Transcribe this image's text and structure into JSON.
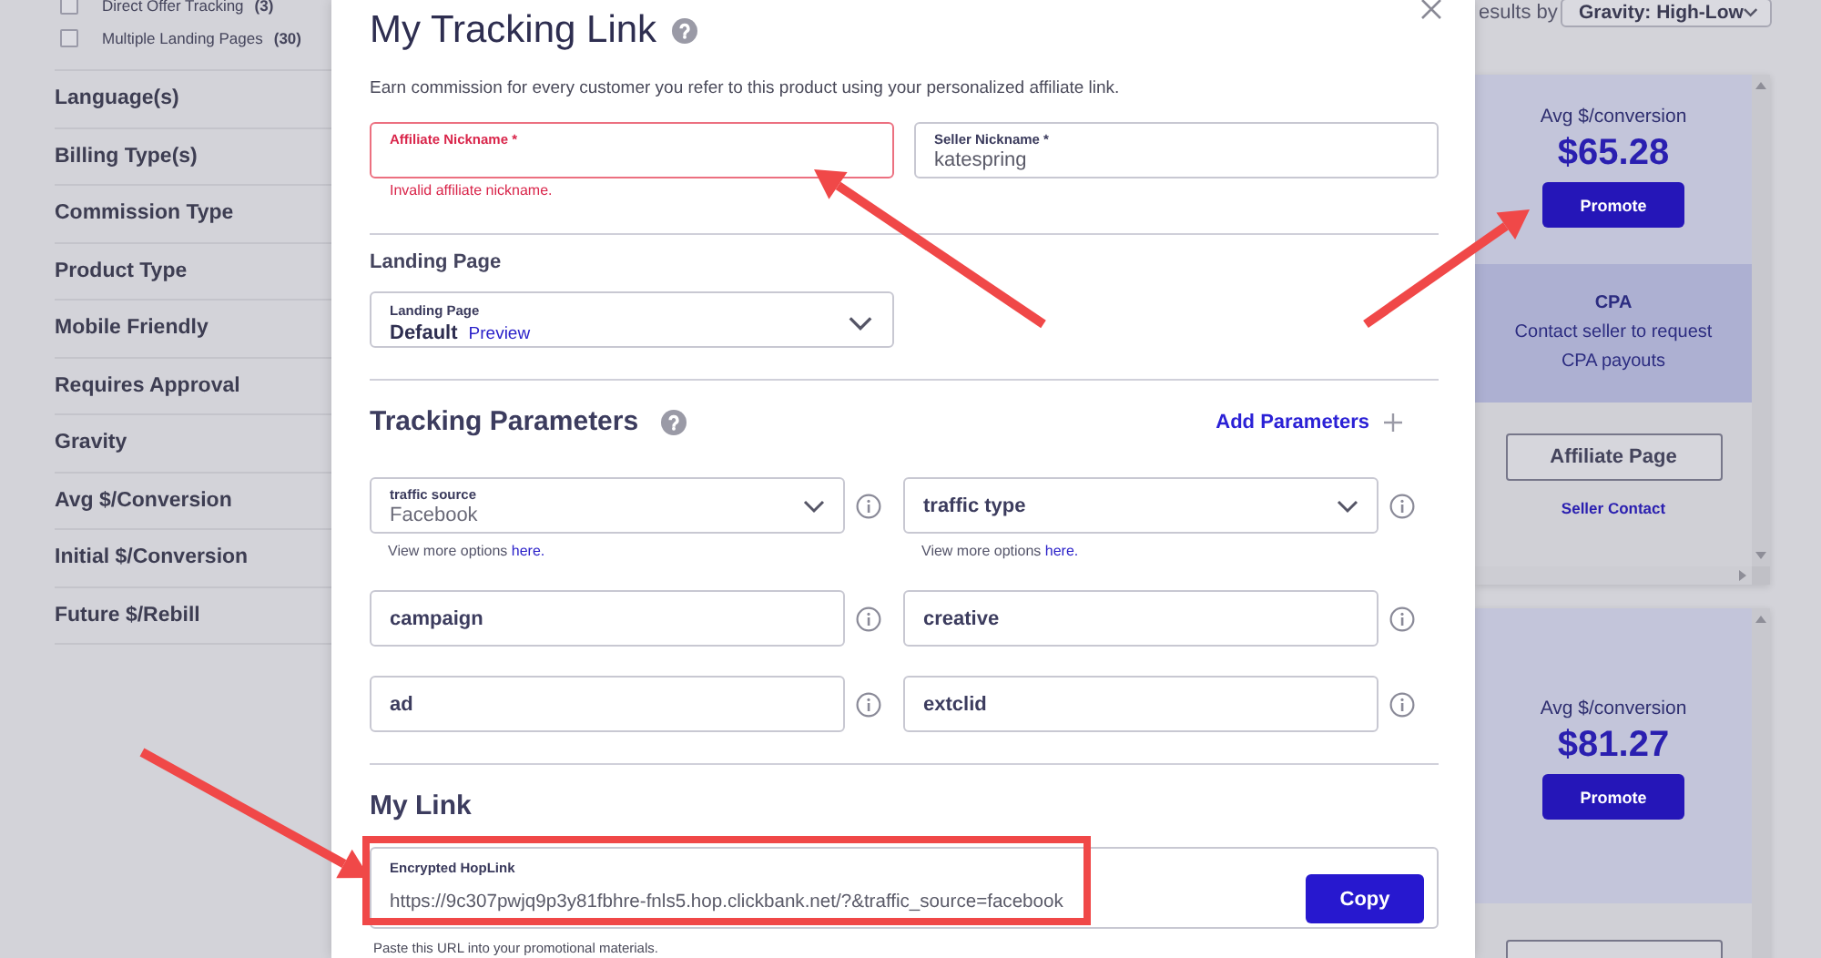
{
  "sidebar": {
    "checkbox_filters": [
      {
        "label": "Direct Offer Tracking",
        "count": "(3)",
        "checked": false
      },
      {
        "label": "Multiple Landing Pages",
        "count": "(30)",
        "checked": false
      }
    ],
    "sections": [
      "Language(s)",
      "Billing Type(s)",
      "Commission Type",
      "Product Type",
      "Mobile Friendly",
      "Requires Approval",
      "Gravity",
      "Avg $/Conversion",
      "Initial $/Conversion",
      "Future $/Rebill"
    ]
  },
  "modal": {
    "title": "My Tracking Link",
    "description": "Earn commission for every customer you refer to this product using your personalized affiliate link.",
    "nickname_fields": [
      {
        "label": "Affiliate Nickname *",
        "invalid": true,
        "error": "Invalid affiliate nickname."
      },
      {
        "label": "Seller Nickname *",
        "value": "katespring",
        "invalid": false
      }
    ],
    "landing_page": {
      "heading": "Landing Page",
      "label": "Landing Page",
      "value": "Default",
      "link": "Preview"
    },
    "tracking": {
      "heading": "Tracking Parameters",
      "add_link": "Add Parameters",
      "params": [
        {
          "kind": "select",
          "label": "traffic source",
          "value": "Facebook",
          "hint": "View more options",
          "hint_link": "here."
        },
        {
          "kind": "select",
          "placeholder": "traffic type",
          "hint": "View more options",
          "hint_link": "here."
        },
        {
          "kind": "text",
          "placeholder": "campaign"
        },
        {
          "kind": "text",
          "placeholder": "creative"
        },
        {
          "kind": "text",
          "placeholder": "ad"
        },
        {
          "kind": "text",
          "placeholder": "extclid"
        }
      ]
    },
    "my_link": {
      "heading": "My Link",
      "label": "Encrypted HopLink",
      "value": "https://9c307pwjq9p3y81fbhre-fnls5.hop.clickbank.net/?&traffic_source=facebook",
      "button": "Copy",
      "hint": "Paste this URL into your promotional materials."
    }
  },
  "results": {
    "sort_label": "esults by",
    "sort_value": "Gravity: High-Low",
    "cards": [
      {
        "avg_label": "Avg $/conversion",
        "avg_value": "$65.28",
        "promote": "Promote",
        "cpa_title": "CPA",
        "cpa_text": "Contact seller to request CPA payouts",
        "affiliate_button": "Affiliate Page",
        "seller_link": "Seller Contact"
      },
      {
        "avg_label": "Avg $/conversion",
        "avg_value": "$81.27",
        "promote": "Promote"
      }
    ]
  }
}
